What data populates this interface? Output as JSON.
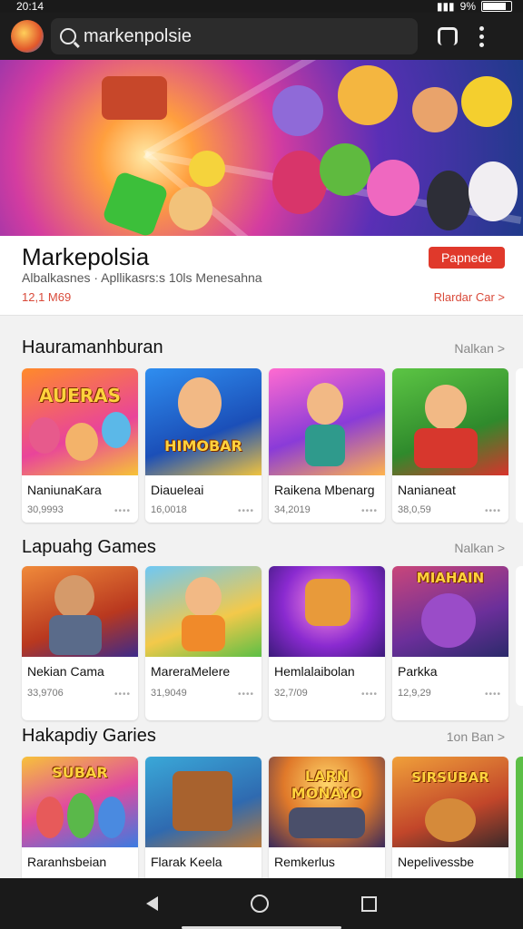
{
  "status": {
    "time": "20:14",
    "battery": "9%"
  },
  "search": {
    "value": "markenpolsie"
  },
  "app": {
    "title": "Markepolsia",
    "subtitle": "Albalkasnes · Apllikasrs:s 10ls Menesahna",
    "count": "12,1 M69",
    "install_label": "Papnede",
    "link_label": "Rlardar Car >"
  },
  "sections": [
    {
      "title": "Hauramanhburan",
      "more": "Nalkan >",
      "cards": [
        {
          "name": "NaniunaKara",
          "meta": "30,9993",
          "art": "AUERAS"
        },
        {
          "name": "Diaueleai",
          "meta": "16,0018",
          "art": "HIMOBAR"
        },
        {
          "name": "Raikena Mbenarg",
          "meta": "34,2019",
          "art": ""
        },
        {
          "name": "Nanianeat",
          "meta": "38,0,59",
          "art": ""
        }
      ]
    },
    {
      "title": "Lapuahg Games",
      "more": "Nalkan >",
      "cards": [
        {
          "name": "Nekian Cama",
          "meta": "33,9706",
          "art": ""
        },
        {
          "name": "MareraMelere",
          "meta": "31,9049",
          "art": ""
        },
        {
          "name": "Hemlalaibolan",
          "meta": "32,7/09",
          "art": ""
        },
        {
          "name": "Parkka",
          "meta": "12,9,29",
          "art": "MIAHAIN"
        }
      ]
    },
    {
      "title": "Hakapdiy Garies",
      "more": "1on Ban >",
      "cards": [
        {
          "name": "Raranhsbeian",
          "meta": "",
          "art": "SUBAR"
        },
        {
          "name": "Flarak Keela",
          "meta": "",
          "art": ""
        },
        {
          "name": "Remkerlus",
          "meta": "",
          "art": "LARN MONAYO"
        },
        {
          "name": "Nepelivessbe",
          "meta": "",
          "art": "SIRSUBAR"
        }
      ]
    }
  ],
  "colors": {
    "accent": "#e0392b",
    "bar": "#1c1c1c"
  }
}
